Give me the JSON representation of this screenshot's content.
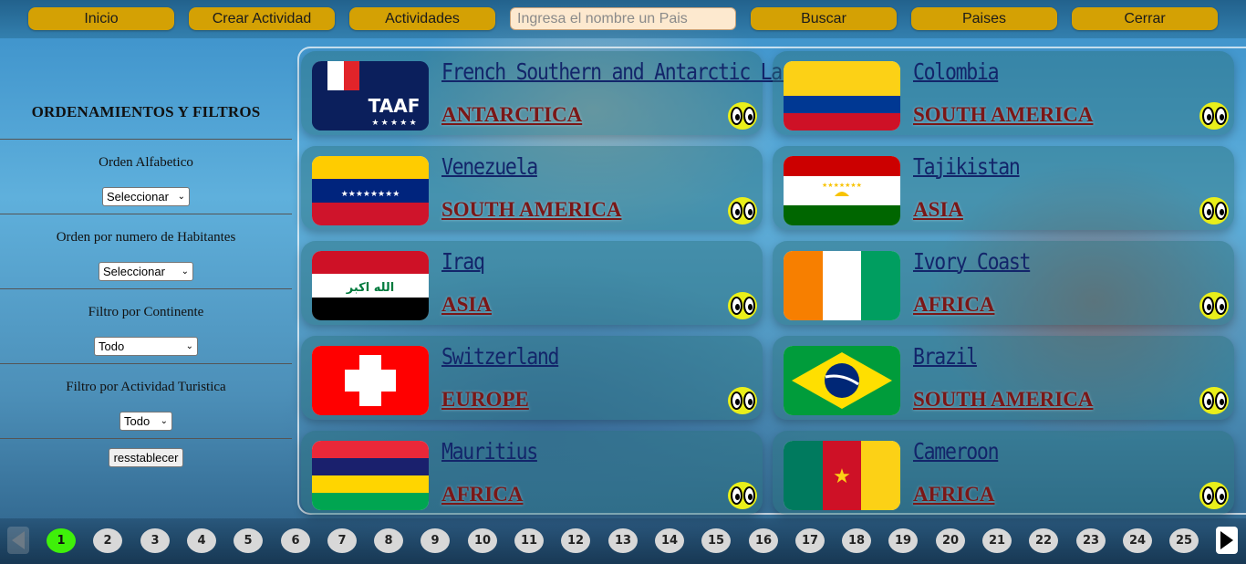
{
  "nav": {
    "home": "Inicio",
    "create_activity": "Crear Actividad",
    "activities": "Actividades",
    "search_placeholder": "Ingresa el nombre un Pais",
    "search": "Buscar",
    "countries": "Paises",
    "close": "Cerrar"
  },
  "sidebar": {
    "title": "ORDENAMIENTOS Y FILTROS",
    "alpha_label": "Orden Alfabetico",
    "alpha_value": "Seleccionar",
    "population_label": "Orden por numero de Habitantes",
    "population_value": "Seleccionar",
    "continent_label": "Filtro por Continente",
    "continent_value": "Todo",
    "activity_label": "Filtro por Actividad Turistica",
    "activity_value": "Todo",
    "reset": "resstablecer"
  },
  "cards": [
    {
      "name": "French Southern and Antarctic Lands",
      "continent": "ANTARCTICA",
      "flag_icon": "french-southern-flag-icon"
    },
    {
      "name": "Colombia",
      "continent": "SOUTH AMERICA",
      "flag_icon": "colombia-flag-icon"
    },
    {
      "name": "Venezuela",
      "continent": "SOUTH AMERICA",
      "flag_icon": "venezuela-flag-icon"
    },
    {
      "name": "Tajikistan",
      "continent": "ASIA",
      "flag_icon": "tajikistan-flag-icon"
    },
    {
      "name": "Iraq",
      "continent": "ASIA",
      "flag_icon": "iraq-flag-icon"
    },
    {
      "name": "Ivory Coast",
      "continent": "AFRICA",
      "flag_icon": "ivory-coast-flag-icon"
    },
    {
      "name": "Switzerland",
      "continent": "EUROPE",
      "flag_icon": "switzerland-flag-icon"
    },
    {
      "name": "Brazil",
      "continent": "SOUTH AMERICA",
      "flag_icon": "brazil-flag-icon"
    },
    {
      "name": "Mauritius",
      "continent": "AFRICA",
      "flag_icon": "mauritius-flag-icon"
    },
    {
      "name": "Cameroon",
      "continent": "AFRICA",
      "flag_icon": "cameroon-flag-icon"
    }
  ],
  "iraq_flag_text": "الله اكبر",
  "pagination": {
    "pages": [
      "1",
      "2",
      "3",
      "4",
      "5",
      "6",
      "7",
      "8",
      "9",
      "10",
      "11",
      "12",
      "13",
      "14",
      "15",
      "16",
      "17",
      "18",
      "19",
      "20",
      "21",
      "22",
      "23",
      "24",
      "25"
    ],
    "current": "1",
    "active_color": "#3ff00a"
  },
  "colors": {
    "nav_button": "#d4a104",
    "country_name": "#13256a",
    "continent": "#7a1717"
  }
}
